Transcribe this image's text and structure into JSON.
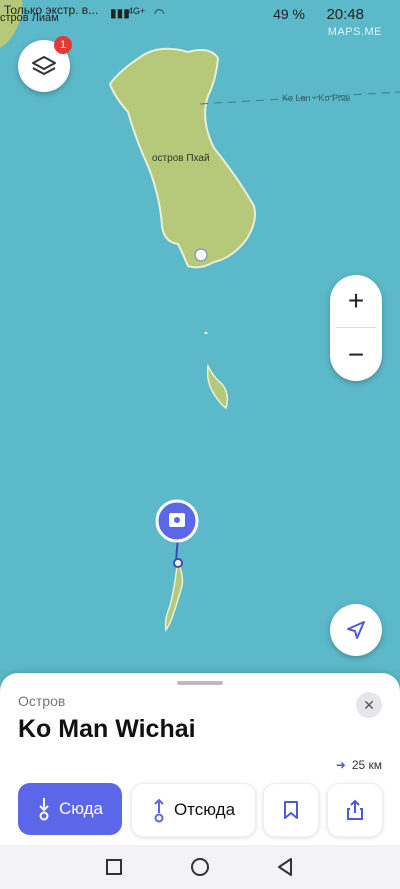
{
  "status_bar": {
    "left_text": "Только экстр. в...",
    "network": "4G+",
    "battery": "49 %",
    "time": "20:48"
  },
  "map": {
    "watermark": "MAPS.ME",
    "top_left_label": "стров Лиам",
    "island_label": "остров Пхай",
    "ferry_label": "Ko Lan - Ko Phai"
  },
  "layers": {
    "badge": "1"
  },
  "zoom": {
    "in": "+",
    "out": "−"
  },
  "place": {
    "category": "Остров",
    "name": "Ko Man Wichai",
    "distance": "25 км"
  },
  "actions": {
    "route_to": "Сюда",
    "route_from": "Отсюда"
  },
  "icons": {
    "layers": "layers-icon",
    "locate": "navigation-arrow-icon",
    "bookmark": "bookmark-icon",
    "share": "share-icon",
    "close": "close-icon",
    "pin": "place-pin-icon"
  }
}
